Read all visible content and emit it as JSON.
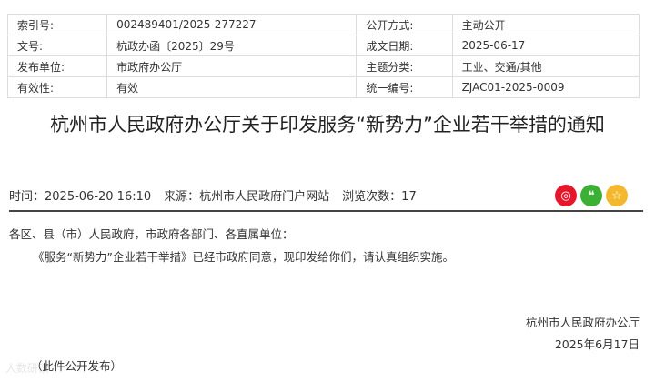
{
  "info_table": [
    [
      {
        "label": "索引号:",
        "value": "002489401/2025-277227"
      },
      {
        "label": "公开方式:",
        "value": "主动公开"
      }
    ],
    [
      {
        "label": "文号:",
        "value": "杭政办函〔2025〕29号"
      },
      {
        "label": "成文日期:",
        "value": "2025-06-17"
      }
    ],
    [
      {
        "label": "发布单位:",
        "value": "市政府办公厅"
      },
      {
        "label": "主题分类:",
        "value": "工业、交通/其他"
      }
    ],
    [
      {
        "label": "有效性:",
        "value": "有效"
      },
      {
        "label": "统一编号:",
        "value": "ZJAC01-2025-0009"
      }
    ]
  ],
  "title": "杭州市人民政府办公厅关于印发服务“新势力”企业若干举措的通知",
  "meta": {
    "time": "时间：2025-06-20 16:10",
    "source": "来源：杭州市人民政府门户网站",
    "views": "浏览次数：17"
  },
  "share_icons": [
    {
      "name": "weibo-icon",
      "color": "#e6162d",
      "glyph": "◎"
    },
    {
      "name": "wechat-icon",
      "color": "#3cb034",
      "glyph": "❝"
    },
    {
      "name": "favorite-icon",
      "color": "#f3b82e",
      "glyph": "☆"
    }
  ],
  "body": {
    "salutation": "各区、县（市）人民政府，市政府各部门、各直属单位：",
    "paragraph": "《服务“新势力”企业若干举措》已经市政府同意，现印发给你们，请认真组织实施。"
  },
  "signature": {
    "org": "杭州市人民政府办公厅",
    "date": "2025年6月17日"
  },
  "note": "（此件公开发布）",
  "watermark": "人数研读"
}
